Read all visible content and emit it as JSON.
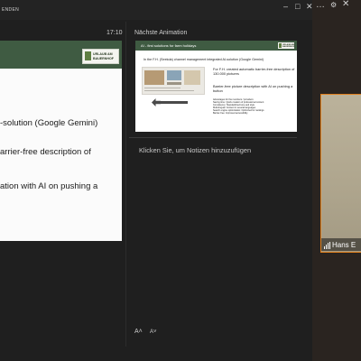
{
  "topbar": {
    "end_label": "ENDEN"
  },
  "window_controls": {
    "minimize": "–",
    "restore": "□",
    "close": "✕"
  },
  "right_toolbar": {
    "more": "…",
    "settings": "⚙",
    "close": "✕"
  },
  "current_slide": {
    "timer": "17:10",
    "logo_lines": [
      "URLAUB AM",
      "BAUERNHOF"
    ],
    "lines": [
      "-solution (Google Gemini)",
      "arrier-free description of",
      "ation with AI on pushing a"
    ]
  },
  "next_animation": {
    "label": "Nächste Animation",
    "slide": {
      "title": "AI - first solutions for farm holidays",
      "logo": "URLAUB AM BAUERNHOF",
      "subtitle": "In the F.H. (Seekda) channel management integrated AI-solution (Google Gemini)",
      "para1": [
        "For F.H. created automatic barrier-free description of",
        "130.000 pictures"
      ],
      "para2": [
        "Barrier-free picture description with AI on pushing a",
        "button"
      ],
      "advantages": [
        "Advantages for the members / providers:",
        "Saving time: Quick creation of professional content",
        "Consistency: Standardized tone and style",
        "Multi-lingual: Content in several languages",
        "Search engine optimization: Optimized for rankings",
        "Barrier-free: Improved accessibility"
      ]
    }
  },
  "notes": {
    "placeholder": "Klicken Sie, um Notizen hinzuzufügen"
  },
  "font_controls": {
    "increase": "A˄",
    "decrease": "A˅"
  },
  "video": {
    "name": "Hans E"
  },
  "colors": {
    "slide_header": "#3f5b42",
    "video_border": "#e0801d",
    "background": "#1f1f1f"
  }
}
